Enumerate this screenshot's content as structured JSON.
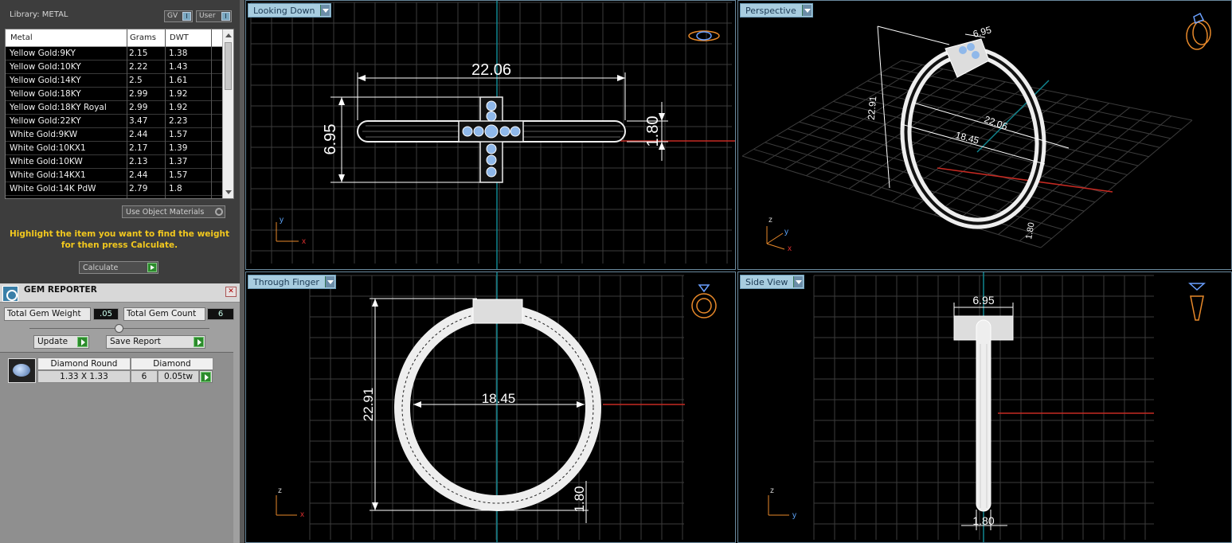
{
  "library": {
    "title": "Library: METAL",
    "toggle_gv": "GV",
    "toggle_user": "User",
    "columns": [
      "Metal",
      "Grams",
      "DWT"
    ],
    "rows": [
      {
        "metal": "Yellow Gold:9KY",
        "grams": "2.15",
        "dwt": "1.38"
      },
      {
        "metal": "Yellow Gold:10KY",
        "grams": "2.22",
        "dwt": "1.43"
      },
      {
        "metal": "Yellow Gold:14KY",
        "grams": "2.5",
        "dwt": "1.61"
      },
      {
        "metal": "Yellow Gold:18KY",
        "grams": "2.99",
        "dwt": "1.92"
      },
      {
        "metal": "Yellow Gold:18KY Royal",
        "grams": "2.99",
        "dwt": "1.92"
      },
      {
        "metal": "Yellow Gold:22KY",
        "grams": "3.47",
        "dwt": "2.23"
      },
      {
        "metal": "White Gold:9KW",
        "grams": "2.44",
        "dwt": "1.57"
      },
      {
        "metal": "White Gold:10KX1",
        "grams": "2.17",
        "dwt": "1.39"
      },
      {
        "metal": "White Gold:10KW",
        "grams": "2.13",
        "dwt": "1.37"
      },
      {
        "metal": "White Gold:14KX1",
        "grams": "2.44",
        "dwt": "1.57"
      },
      {
        "metal": "White Gold:14K PdW",
        "grams": "2.79",
        "dwt": "1.8"
      }
    ],
    "use_object_materials": "Use Object Materials",
    "hint": "Highlight the item you want to find the weight for then press Calculate.",
    "calculate": "Calculate"
  },
  "gem_reporter": {
    "title": "GEM REPORTER",
    "close": "✕",
    "total_weight_label": "Total Gem Weight",
    "total_weight_value": ".05",
    "total_count_label": "Total Gem Count",
    "total_count_value": "6",
    "update": "Update",
    "save_report": "Save Report",
    "gem": {
      "shape": "Diamond Round",
      "size": "1.33 X 1.33",
      "material": "Diamond",
      "count": "6",
      "weight": "0.05tw"
    }
  },
  "viewports": {
    "top_left": {
      "label": "Looking Down",
      "dim_width": "22.06",
      "dim_height": "6.95",
      "dim_band": "1.80",
      "axis_a": "y",
      "axis_b": "x"
    },
    "top_right": {
      "label": "Perspective",
      "dim_top": "6.95",
      "dim_height": "22.91",
      "dim_width": "22.06",
      "dim_inner": "18.45",
      "dim_band": "1.80",
      "axis_a": "z",
      "axis_b": "y",
      "axis_c": "x"
    },
    "bottom_left": {
      "label": "Through Finger",
      "dim_height": "22.91",
      "dim_inner": "18.45",
      "dim_band": "1.80",
      "axis_a": "z",
      "axis_b": "x"
    },
    "bottom_right": {
      "label": "Side View",
      "dim_top": "6.95",
      "dim_band": "1.80",
      "axis_a": "z",
      "axis_b": "y"
    }
  },
  "colors": {
    "grid": "#3c3c3c",
    "axis_red": "#c62a22",
    "axis_teal": "#11858f",
    "gem_blue": "#8fb8ea",
    "hint_yellow": "#f2c81e",
    "icon_orange": "#e8892a"
  }
}
